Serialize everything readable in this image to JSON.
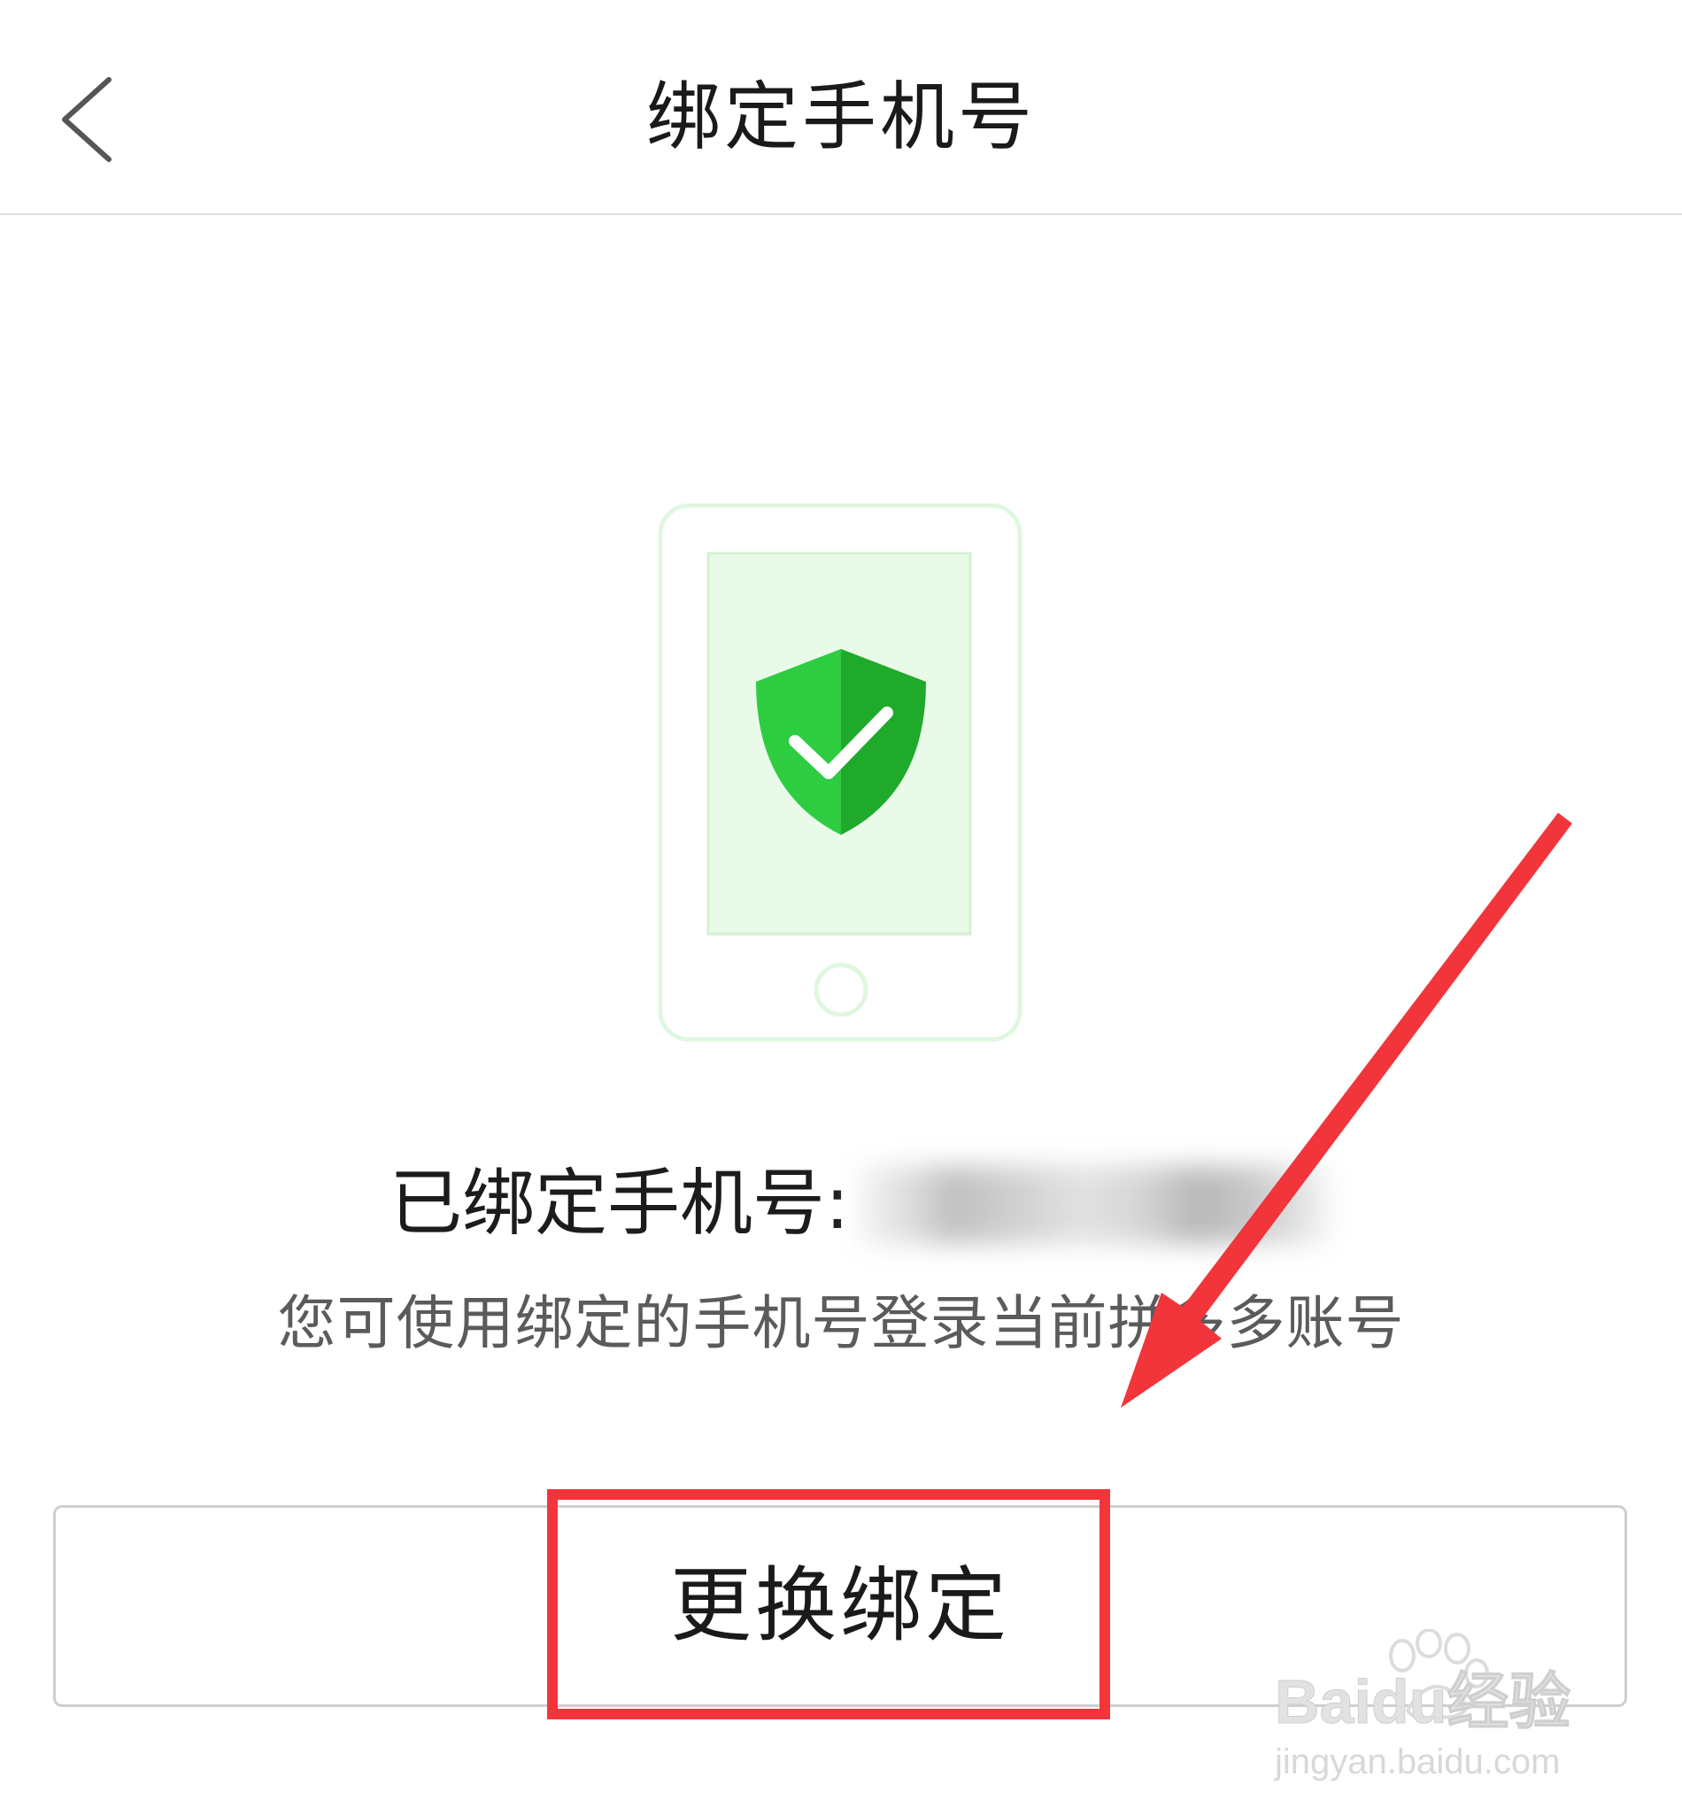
{
  "header": {
    "title": "绑定手机号",
    "back_icon": "chevron-left-icon"
  },
  "illustration": {
    "icon": "phone-shield-check-icon",
    "colors": {
      "phone_outline": "#e0f7df",
      "screen_fill": "#e9fbe8",
      "shield_light": "#2ecc40",
      "shield_dark": "#1faa2b"
    }
  },
  "binding": {
    "label": "已绑定手机号:",
    "value_obscured": true
  },
  "hint": "您可使用绑定的手机号登录当前拼多多账号",
  "actions": {
    "change_binding_label": "更换绑定"
  },
  "annotations": {
    "highlight_color": "#f2353a",
    "arrow_color": "#f2353a"
  },
  "watermark": {
    "brand": "Baidu经验",
    "url": "jingyan.baidu.com"
  }
}
